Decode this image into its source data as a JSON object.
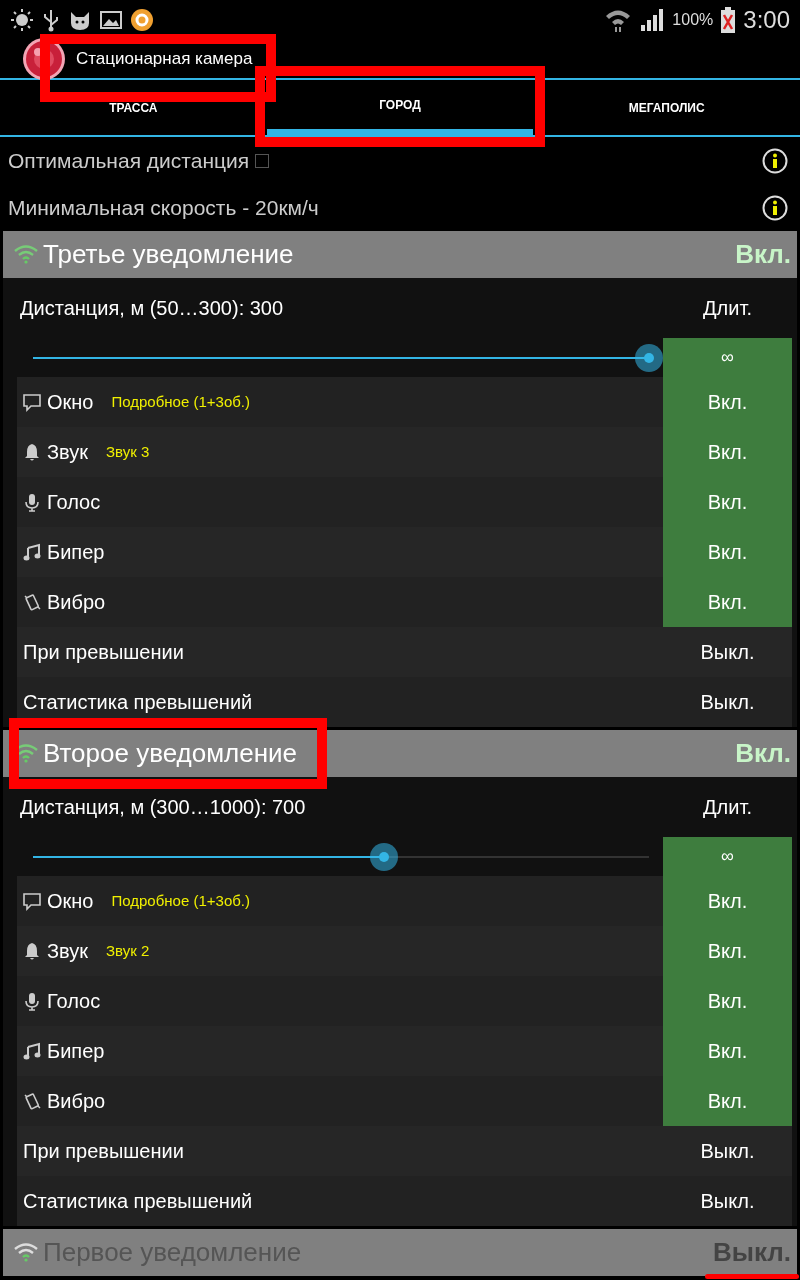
{
  "status_bar": {
    "battery": "100%",
    "time": "3:00"
  },
  "app_bar": {
    "title": "Стационарная камера",
    "highlighted": true
  },
  "tabs": [
    {
      "label": "ТРАССА",
      "selected": false
    },
    {
      "label": "ГОРОД",
      "selected": true,
      "highlighted": true
    },
    {
      "label": "МЕГАПОЛИС",
      "selected": false
    }
  ],
  "settings": [
    {
      "label": "Оптимальная дистанция",
      "kind": "checkbox",
      "checked": false
    },
    {
      "label": "Минимальная скорость - 20км/ч",
      "kind": "text"
    }
  ],
  "sections": [
    {
      "title": "Третье уведомление",
      "enabled": true,
      "state": "Вкл.",
      "distance": "Дистанция, м (50…300): 300",
      "duration_label": "Длит.",
      "duration": "∞",
      "level": 1.0,
      "rows": [
        {
          "kind": "window",
          "label": "Окно",
          "detail": "Подробное (1+3об.)",
          "value": "Вкл.",
          "on": true
        },
        {
          "kind": "sound",
          "label": "Звук",
          "detail": "Звук 3",
          "value": "Вкл.",
          "on": true
        },
        {
          "kind": "voice",
          "label": "Голос",
          "value": "Вкл.",
          "on": true
        },
        {
          "kind": "beeper",
          "label": "Бипер",
          "value": "Вкл.",
          "on": true
        },
        {
          "kind": "vibro",
          "label": "Вибро",
          "value": "Вкл.",
          "on": true
        },
        {
          "kind": "plain",
          "label": "При превышении",
          "value": "Выкл.",
          "on": false
        },
        {
          "kind": "plain",
          "label": "Статистика превышений",
          "value": "Выкл.",
          "on": false
        }
      ]
    },
    {
      "title": "Второе уведомление",
      "enabled": true,
      "state": "Вкл.",
      "highlighted": true,
      "distance": "Дистанция, м (300…1000): 700",
      "duration_label": "Длит.",
      "duration": "∞",
      "level": 0.57,
      "rows": [
        {
          "kind": "window",
          "label": "Окно",
          "detail": "Подробное (1+3об.)",
          "value": "Вкл.",
          "on": true
        },
        {
          "kind": "sound",
          "label": "Звук",
          "detail": "Звук 2",
          "value": "Вкл.",
          "on": true
        },
        {
          "kind": "voice",
          "label": "Голос",
          "value": "Вкл.",
          "on": true
        },
        {
          "kind": "beeper",
          "label": "Бипер",
          "value": "Вкл.",
          "on": true
        },
        {
          "kind": "vibro",
          "label": "Вибро",
          "value": "Вкл.",
          "on": true
        },
        {
          "kind": "plain",
          "label": "При превышении",
          "value": "Выкл.",
          "on": false
        },
        {
          "kind": "plain",
          "label": "Статистика превышений",
          "value": "Выкл.",
          "on": false
        }
      ]
    },
    {
      "title": "Первое уведомление",
      "enabled": false,
      "state": "Выкл.",
      "state_underlined": true
    }
  ]
}
